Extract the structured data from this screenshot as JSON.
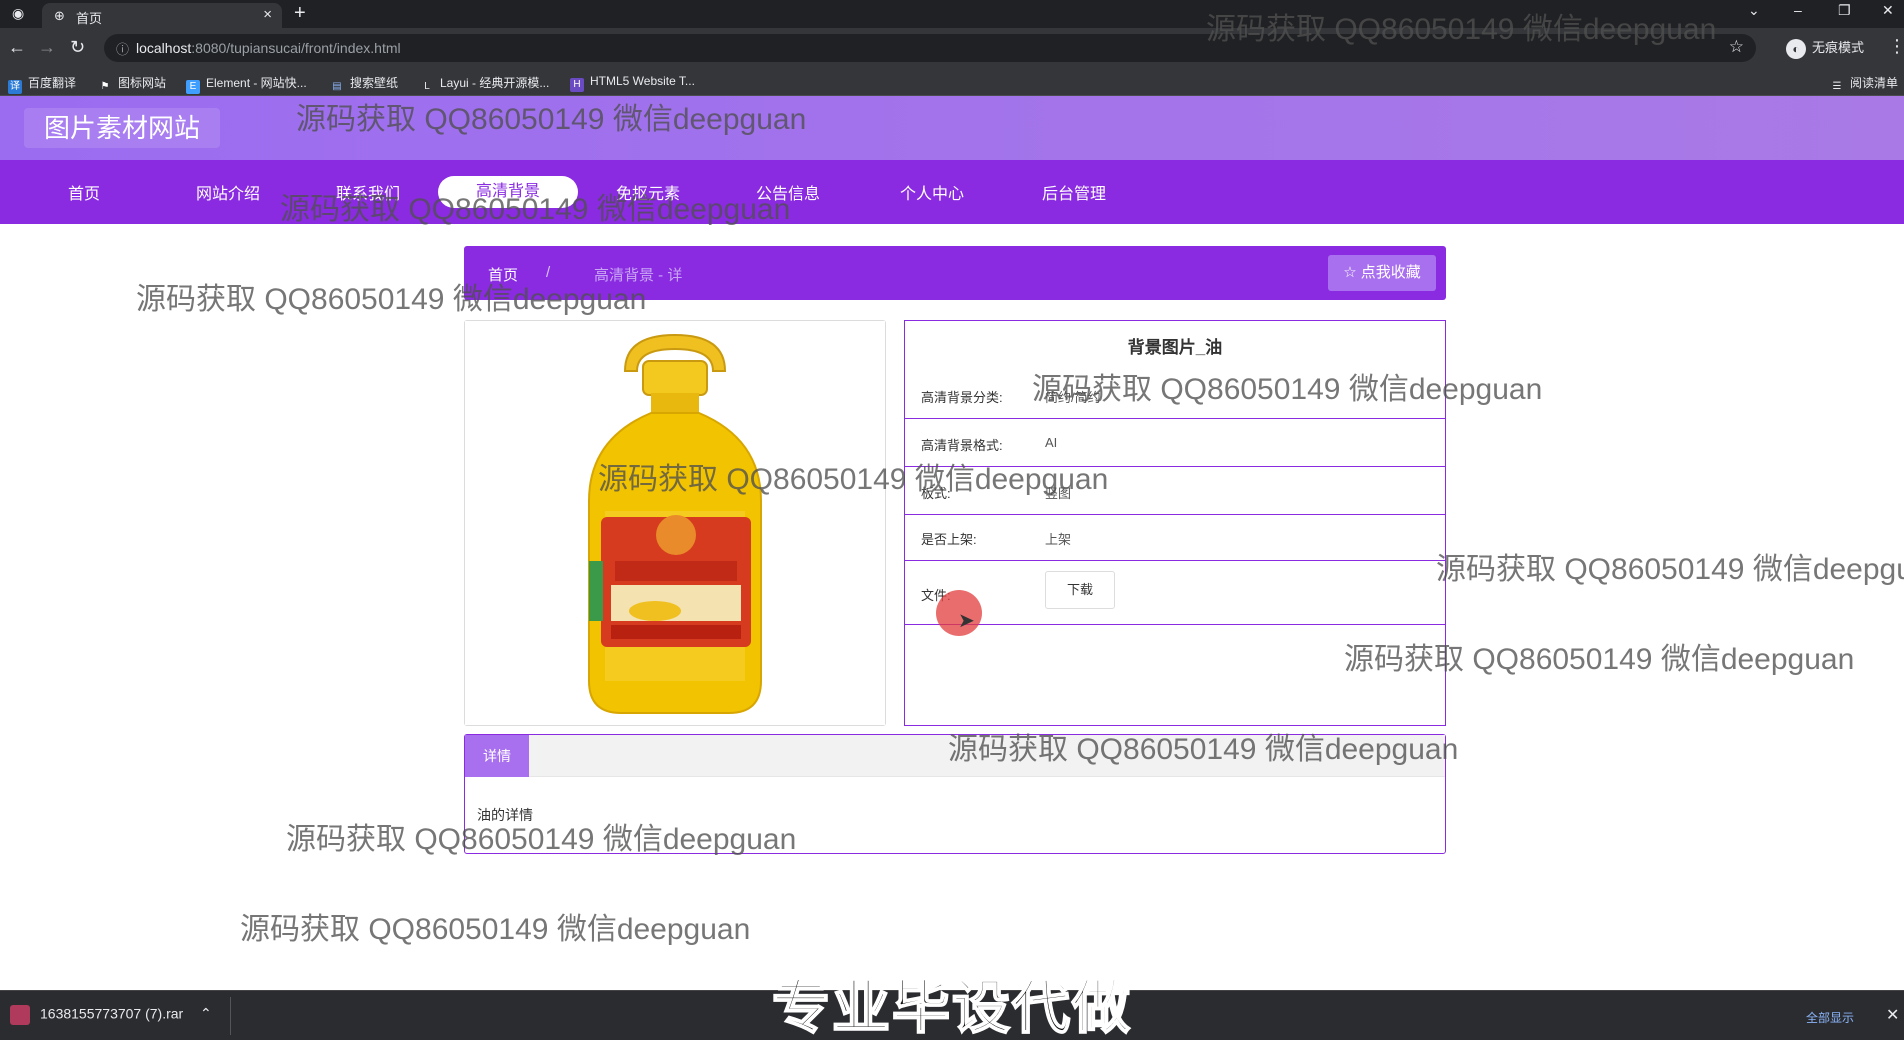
{
  "browser": {
    "tab_title": "首页",
    "url_host": "localhost",
    "url_rest": ":8080/tupiansucai/front/index.html",
    "incognito_label": "无痕模式",
    "bookmarks": [
      "百度翻译",
      "图标网站",
      "Element - 网站快...",
      "搜索壁纸",
      "Layui - 经典开源模...",
      "HTML5 Website T..."
    ],
    "reading_list": "阅读清单"
  },
  "site": {
    "logo": "图片素材网站",
    "nav": [
      "首页",
      "网站介绍",
      "联系我们",
      "高清背景",
      "免抠元素",
      "公告信息",
      "个人中心",
      "后台管理"
    ],
    "active_nav": "高清背景"
  },
  "breadcrumb": {
    "home": "首页",
    "separator": "/",
    "current": "高清背景 - 详",
    "favorite_button": "☆ 点我收藏"
  },
  "detail": {
    "title": "背景图片_油",
    "rows": [
      {
        "label": "高清背景分类:",
        "value": "简约/简约"
      },
      {
        "label": "高清背景格式:",
        "value": "AI"
      },
      {
        "label": "板式:",
        "value": "竖图"
      },
      {
        "label": "是否上架:",
        "value": "上架"
      },
      {
        "label": "文件:",
        "value": ""
      }
    ],
    "download_button": "下载",
    "tab_label": "详情",
    "description": "油的详情"
  },
  "image_alt": "食用油瓶图片",
  "watermark": "源码获取 QQ86050149 微信deepguan",
  "download_bar": {
    "file_name": "1638155773707 (7).rar",
    "show_all": "全部显示"
  },
  "caption": "专业毕设代做"
}
